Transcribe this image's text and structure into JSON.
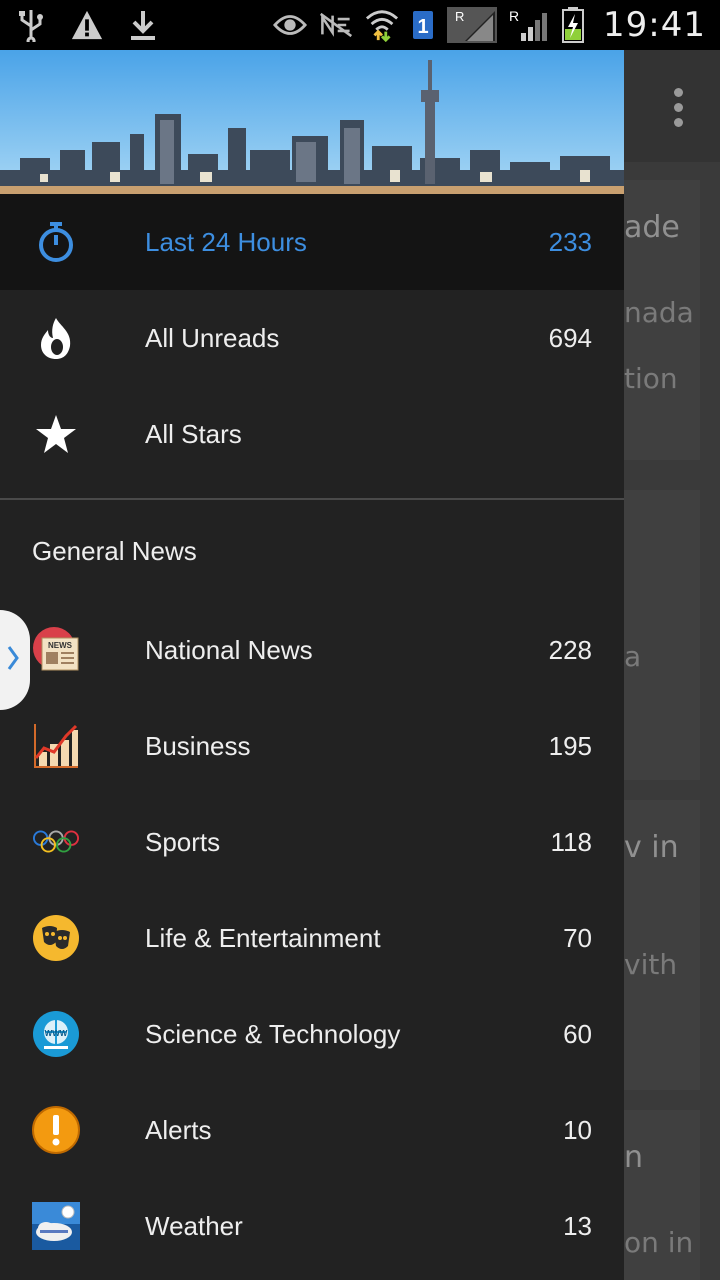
{
  "statusbar": {
    "time": "19:41",
    "sim_slot": "1",
    "roaming_1": "R",
    "roaming_2": "R",
    "icons": [
      "usb-icon",
      "warning-icon",
      "download-icon",
      "eye-icon",
      "nfc-off-icon",
      "wifi-icon",
      "sim-icon",
      "signal-icon",
      "signal-icon",
      "battery-charging-icon"
    ]
  },
  "drawer": {
    "primary": [
      {
        "label": "Last 24 Hours",
        "count": "233",
        "icon": "stopwatch-icon",
        "active": true
      },
      {
        "label": "All Unreads",
        "count": "694",
        "icon": "flame-icon"
      },
      {
        "label": "All Stars",
        "count": "",
        "icon": "star-icon"
      }
    ],
    "section_title": "General News",
    "feeds": [
      {
        "label": "National News",
        "count": "228",
        "icon": "newspaper-icon"
      },
      {
        "label": "Business",
        "count": "195",
        "icon": "chart-icon"
      },
      {
        "label": "Sports",
        "count": "118",
        "icon": "olympic-rings-icon"
      },
      {
        "label": "Life & Entertainment",
        "count": "70",
        "icon": "theater-masks-icon"
      },
      {
        "label": "Science & Technology",
        "count": "60",
        "icon": "globe-www-icon"
      },
      {
        "label": "Alerts",
        "count": "10",
        "icon": "alert-icon"
      },
      {
        "label": "Weather",
        "count": "13",
        "icon": "weather-icon"
      }
    ]
  },
  "background": {
    "fragments": [
      "ade",
      "nada",
      "tion",
      "a",
      "v in",
      "vith",
      "n",
      "on in"
    ]
  },
  "colors": {
    "accent": "#3d8ee0",
    "drawer_bg": "#222222",
    "active_bg": "#141414",
    "text": "#eeeeee"
  }
}
